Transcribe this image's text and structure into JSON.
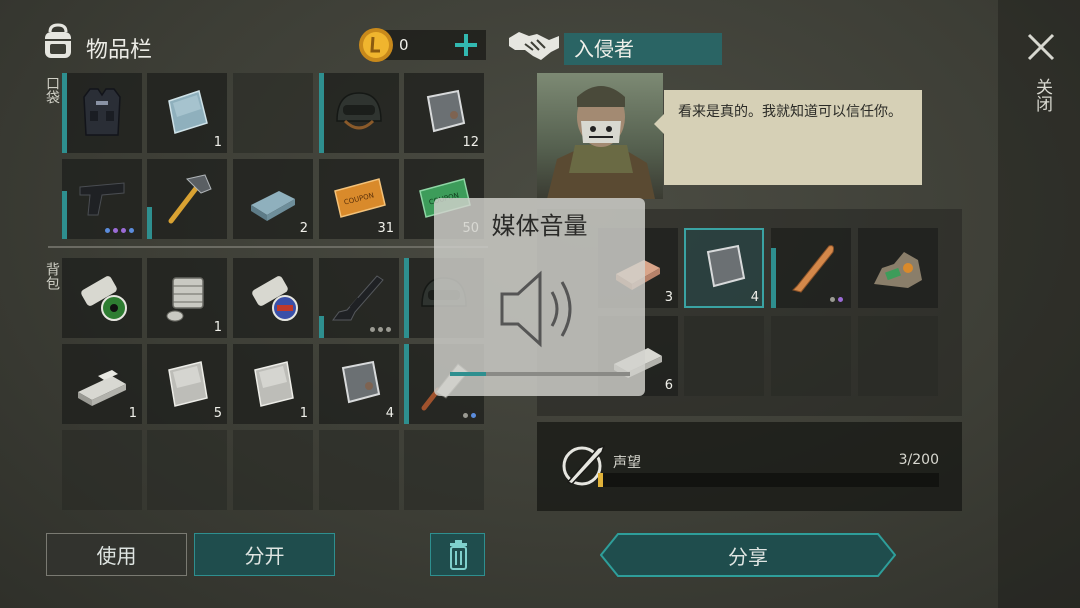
{
  "inventory": {
    "title": "物品栏",
    "coins": "0",
    "pocket_label": "口袋",
    "backpack_label": "背包",
    "pocket_counts": [
      "",
      "1",
      "",
      "",
      "12",
      "",
      "",
      "2",
      "31",
      "50"
    ],
    "backpack_counts": [
      "",
      "1",
      "",
      "",
      "",
      "1",
      "5",
      "1",
      "4",
      ""
    ]
  },
  "trader": {
    "name": "入侵者",
    "dialog": "看来是真的。我就知道可以信任你。",
    "trade_counts": [
      "3",
      "4",
      "",
      "",
      "6"
    ],
    "reputation_label": "声望",
    "reputation_value": "3/200",
    "reputation_progress": 0.015
  },
  "buttons": {
    "use": "使用",
    "split": "分开",
    "share": "分享",
    "close": "关闭"
  },
  "volume_overlay": {
    "title": "媒体音量",
    "level": 0.2
  },
  "colors": {
    "accent": "#2e8f8f",
    "rarity_blue": "#5b8cdc",
    "rarity_purple": "#9b6bd6"
  }
}
